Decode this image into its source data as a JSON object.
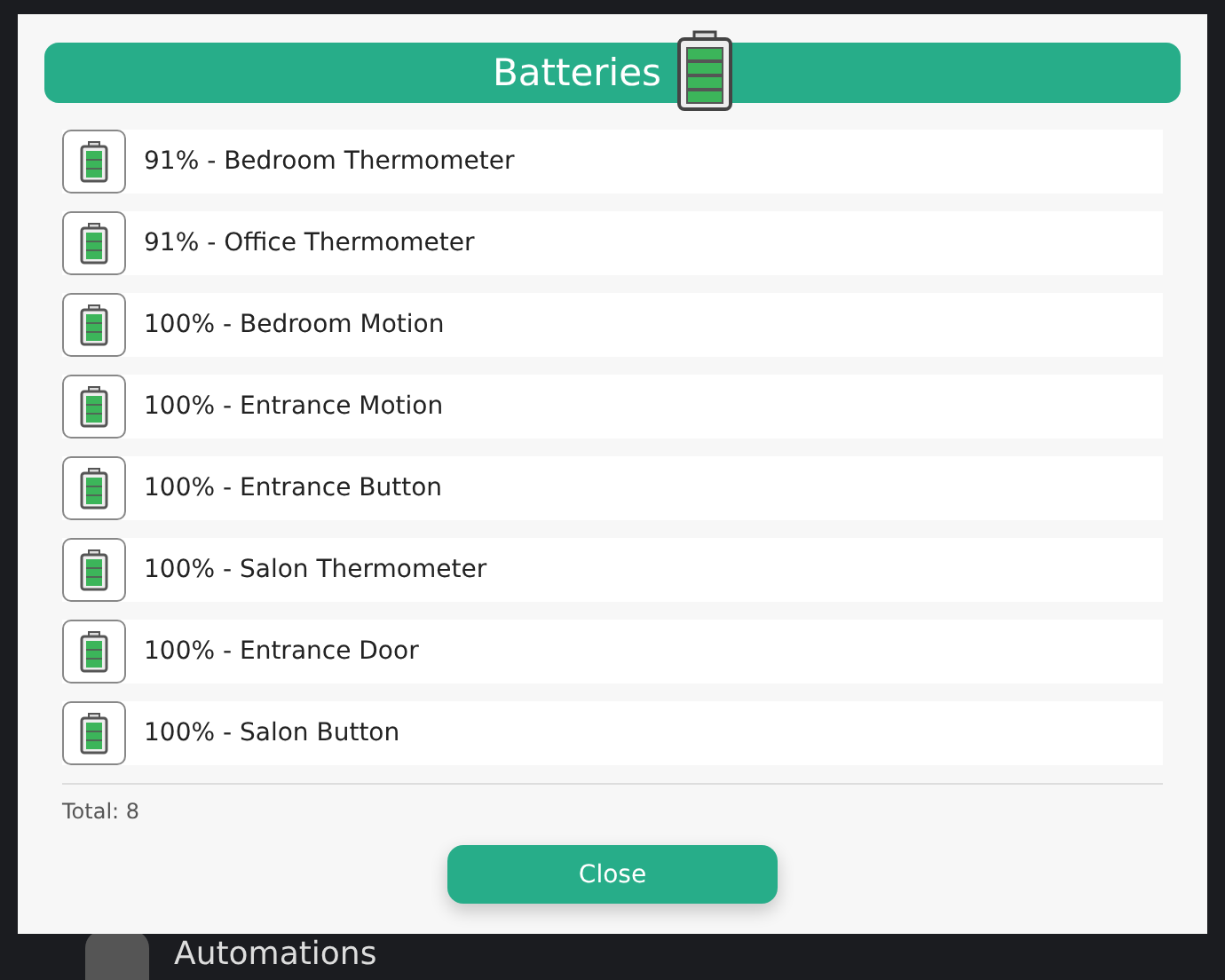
{
  "background": {
    "menu_item": "Automations"
  },
  "dialog": {
    "title": "Batteries",
    "devices": [
      {
        "label": "91% - Bedroom Thermometer"
      },
      {
        "label": "91% - Office Thermometer"
      },
      {
        "label": "100% - Bedroom Motion"
      },
      {
        "label": "100% - Entrance Motion"
      },
      {
        "label": "100% - Entrance Button"
      },
      {
        "label": "100% - Salon Thermometer"
      },
      {
        "label": "100% - Entrance Door"
      },
      {
        "label": "100% - Salon Button"
      }
    ],
    "total": "Total: 8",
    "button": "Close"
  }
}
